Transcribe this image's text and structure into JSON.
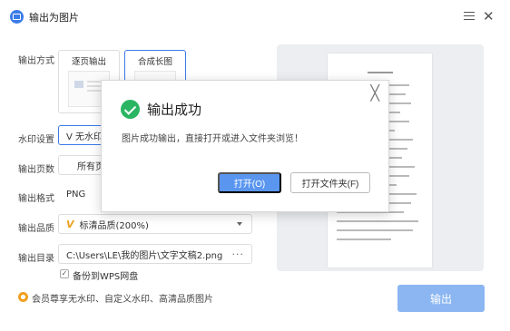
{
  "window": {
    "title": "输出为图片"
  },
  "form": {
    "output_mode": {
      "label": "输出方式",
      "options": [
        "逐页输出",
        "合成长图"
      ],
      "selected": "合成长图"
    },
    "watermark": {
      "label": "水印设置",
      "value": "V 无水印"
    },
    "pages": {
      "label": "输出页数",
      "value": "所有页"
    },
    "format": {
      "label": "输出格式",
      "value": "PNG"
    },
    "quality": {
      "label": "输出品质",
      "value": "标清品质(200%)"
    },
    "directory": {
      "label": "输出目录",
      "value": "C:\\Users\\LE\\我的图片\\文字文稿2.png",
      "browse": "···"
    },
    "backup": {
      "label": "备份到WPS网盘",
      "checked": true
    }
  },
  "vip_note": "会员尊享无水印、自定义水印、高清品质图片",
  "export_button": "输出",
  "dialog": {
    "title": "输出成功",
    "message": "图片成功输出，直接打开或进入文件夹浏览！",
    "open_button": "打开(O)",
    "open_folder_button": "打开文件夹(F)",
    "close": "╳"
  },
  "colors": {
    "accent": "#3b7be8",
    "success": "#2ab563",
    "export_disabled": "#8bb6f2",
    "vip": "#f0a020"
  }
}
